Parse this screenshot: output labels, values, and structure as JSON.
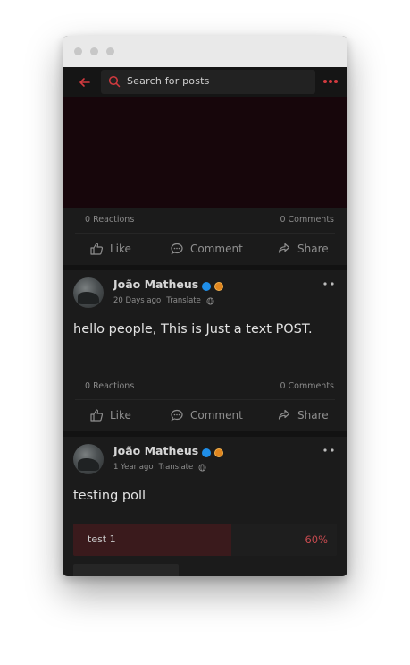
{
  "search": {
    "placeholder": "Search for posts"
  },
  "colors": {
    "accent": "#d23a3f",
    "background": "#1b1b1b"
  },
  "posts": [
    {
      "reactions": "0 Reactions",
      "comments": "0 Comments",
      "actions": {
        "like": "Like",
        "comment": "Comment",
        "share": "Share"
      }
    },
    {
      "author": "João Matheus",
      "time": "20 Days ago",
      "translate": "Translate",
      "text": "hello people, This is Just a text POST.",
      "reactions": "0 Reactions",
      "comments": "0 Comments",
      "actions": {
        "like": "Like",
        "comment": "Comment",
        "share": "Share"
      }
    },
    {
      "author": "João Matheus",
      "time": "1 Year ago",
      "translate": "Translate",
      "text": "testing poll",
      "poll": [
        {
          "label": "test 1",
          "percent": "60%",
          "fraction": 0.6
        }
      ]
    }
  ]
}
